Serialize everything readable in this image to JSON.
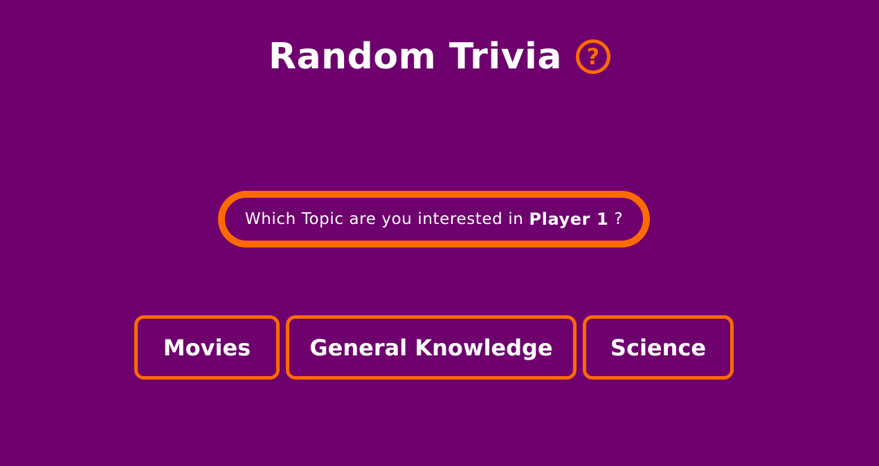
{
  "header": {
    "title": "Random Trivia",
    "help_icon_glyph": "?",
    "help_icon": "question-circle-icon"
  },
  "prompt": {
    "text_before": "Which Topic are you interested in",
    "player": "Player 1",
    "text_after": "?"
  },
  "topics": [
    {
      "label": "Movies"
    },
    {
      "label": "General Knowledge"
    },
    {
      "label": "Science"
    }
  ],
  "colors": {
    "background": "#6e016d",
    "accent": "#ff6a00",
    "text": "#ffffff"
  }
}
